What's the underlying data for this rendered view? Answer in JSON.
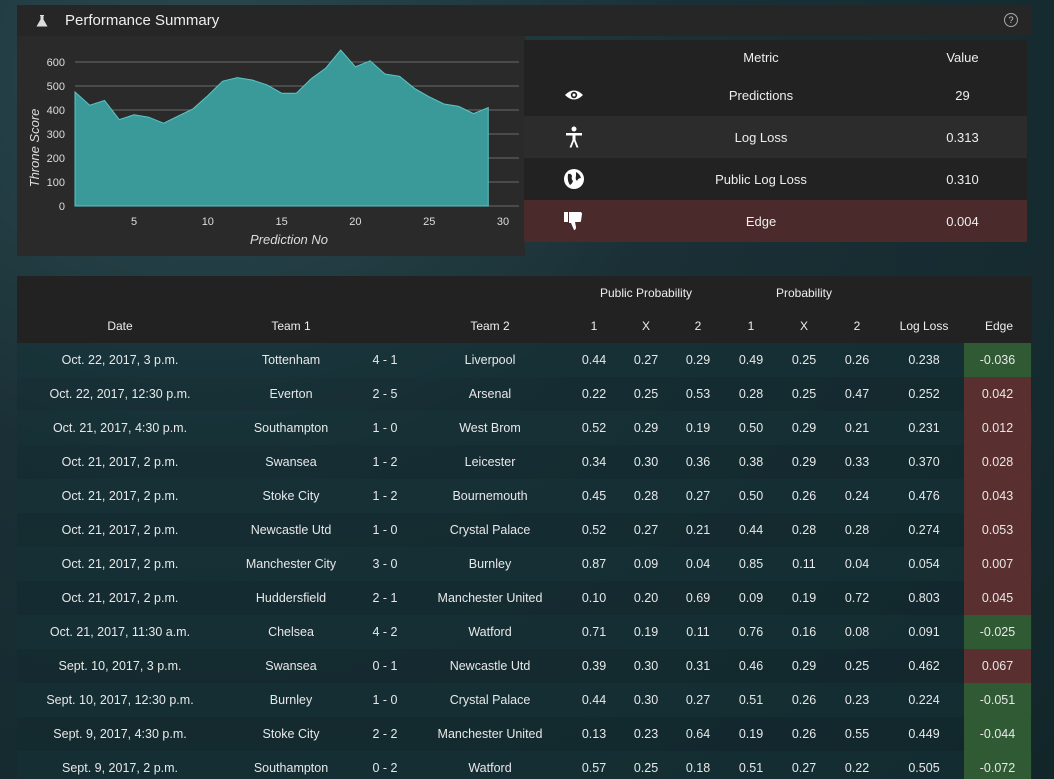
{
  "header": {
    "title": "Performance Summary"
  },
  "chart_data": {
    "type": "area",
    "title": "",
    "xlabel": "Prediction No",
    "ylabel": "Throne Score",
    "xlim": [
      1,
      30
    ],
    "ylim": [
      0,
      650
    ],
    "xticks": [
      5,
      10,
      15,
      20,
      25,
      30
    ],
    "yticks": [
      0,
      100,
      200,
      300,
      400,
      500,
      600
    ],
    "color": "#3a9a9a",
    "x": [
      1,
      2,
      3,
      4,
      5,
      6,
      7,
      8,
      9,
      10,
      11,
      12,
      13,
      14,
      15,
      16,
      17,
      18,
      19,
      20,
      21,
      22,
      23,
      24,
      25,
      26,
      27,
      28,
      29
    ],
    "y": [
      475,
      420,
      440,
      360,
      380,
      370,
      345,
      375,
      405,
      460,
      520,
      535,
      525,
      505,
      470,
      470,
      530,
      575,
      650,
      580,
      605,
      550,
      540,
      490,
      455,
      425,
      415,
      385,
      410
    ]
  },
  "metrics": {
    "head_metric": "Metric",
    "head_value": "Value",
    "rows": [
      {
        "name": "Predictions",
        "value": "29",
        "icon": "eye-icon"
      },
      {
        "name": "Log Loss",
        "value": "0.313",
        "icon": "accessibility-icon"
      },
      {
        "name": "Public Log Loss",
        "value": "0.310",
        "icon": "globe-icon"
      },
      {
        "name": "Edge",
        "value": "0.004",
        "icon": "thumbs-down-icon"
      }
    ]
  },
  "table": {
    "group_public": "Public Probability",
    "group_prob": "Probability",
    "headers": {
      "date": "Date",
      "team1": "Team 1",
      "team2": "Team 2",
      "p1": "1",
      "px": "X",
      "p2": "2",
      "q1": "1",
      "qx": "X",
      "q2": "2",
      "logloss": "Log Loss",
      "edge": "Edge"
    },
    "rows": [
      [
        "Oct. 22, 2017, 3 p.m.",
        "Tottenham",
        "4 - 1",
        "Liverpool",
        "0.44",
        "0.27",
        "0.29",
        "0.49",
        "0.25",
        "0.26",
        "0.238",
        "-0.036"
      ],
      [
        "Oct. 22, 2017, 12:30 p.m.",
        "Everton",
        "2 - 5",
        "Arsenal",
        "0.22",
        "0.25",
        "0.53",
        "0.28",
        "0.25",
        "0.47",
        "0.252",
        "0.042"
      ],
      [
        "Oct. 21, 2017, 4:30 p.m.",
        "Southampton",
        "1 - 0",
        "West Brom",
        "0.52",
        "0.29",
        "0.19",
        "0.50",
        "0.29",
        "0.21",
        "0.231",
        "0.012"
      ],
      [
        "Oct. 21, 2017, 2 p.m.",
        "Swansea",
        "1 - 2",
        "Leicester",
        "0.34",
        "0.30",
        "0.36",
        "0.38",
        "0.29",
        "0.33",
        "0.370",
        "0.028"
      ],
      [
        "Oct. 21, 2017, 2 p.m.",
        "Stoke City",
        "1 - 2",
        "Bournemouth",
        "0.45",
        "0.28",
        "0.27",
        "0.50",
        "0.26",
        "0.24",
        "0.476",
        "0.043"
      ],
      [
        "Oct. 21, 2017, 2 p.m.",
        "Newcastle Utd",
        "1 - 0",
        "Crystal Palace",
        "0.52",
        "0.27",
        "0.21",
        "0.44",
        "0.28",
        "0.28",
        "0.274",
        "0.053"
      ],
      [
        "Oct. 21, 2017, 2 p.m.",
        "Manchester City",
        "3 - 0",
        "Burnley",
        "0.87",
        "0.09",
        "0.04",
        "0.85",
        "0.11",
        "0.04",
        "0.054",
        "0.007"
      ],
      [
        "Oct. 21, 2017, 2 p.m.",
        "Huddersfield",
        "2 - 1",
        "Manchester United",
        "0.10",
        "0.20",
        "0.69",
        "0.09",
        "0.19",
        "0.72",
        "0.803",
        "0.045"
      ],
      [
        "Oct. 21, 2017, 11:30 a.m.",
        "Chelsea",
        "4 - 2",
        "Watford",
        "0.71",
        "0.19",
        "0.11",
        "0.76",
        "0.16",
        "0.08",
        "0.091",
        "-0.025"
      ],
      [
        "Sept. 10, 2017, 3 p.m.",
        "Swansea",
        "0 - 1",
        "Newcastle Utd",
        "0.39",
        "0.30",
        "0.31",
        "0.46",
        "0.29",
        "0.25",
        "0.462",
        "0.067"
      ],
      [
        "Sept. 10, 2017, 12:30 p.m.",
        "Burnley",
        "1 - 0",
        "Crystal Palace",
        "0.44",
        "0.30",
        "0.27",
        "0.51",
        "0.26",
        "0.23",
        "0.224",
        "-0.051"
      ],
      [
        "Sept. 9, 2017, 4:30 p.m.",
        "Stoke City",
        "2 - 2",
        "Manchester United",
        "0.13",
        "0.23",
        "0.64",
        "0.19",
        "0.26",
        "0.55",
        "0.449",
        "-0.044"
      ],
      [
        "Sept. 9, 2017, 2 p.m.",
        "Southampton",
        "0 - 2",
        "Watford",
        "0.57",
        "0.25",
        "0.18",
        "0.51",
        "0.27",
        "0.22",
        "0.505",
        "-0.072"
      ]
    ]
  }
}
